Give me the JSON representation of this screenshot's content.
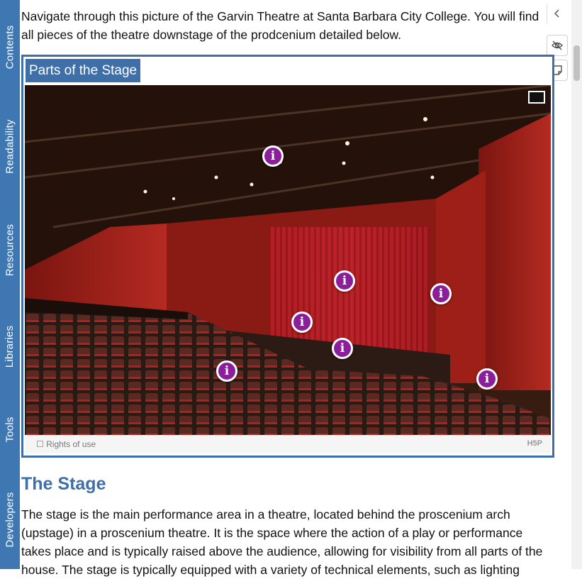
{
  "sidebar": {
    "tabs": [
      {
        "label": "Contents"
      },
      {
        "label": "Readability"
      },
      {
        "label": "Resources"
      },
      {
        "label": "Libraries"
      },
      {
        "label": "Tools"
      },
      {
        "label": "Developers"
      }
    ]
  },
  "toolbar": {
    "collapse_icon": "chevron-left-icon",
    "hide_icon": "eye-off-icon",
    "notes_icon": "sticky-note-icon"
  },
  "intro": "Navigate through this picture of the Garvin Theatre at Santa Barbara City College. You will find all pieces of the theatre downstage of the prodcenium detailed below.",
  "widget": {
    "title": "Parts of the Stage",
    "hotspot_label": "i",
    "rights_label": "Rights of use",
    "brand": "H5P"
  },
  "section": {
    "heading": "The Stage",
    "paragraph": "The stage is the main performance area in a theatre, located behind the proscenium arch (upstage) in a proscenium theatre. It is the space where the action of a play or performance takes place and is typically raised above the audience, allowing for visibility from all parts of the house. The stage is typically equipped with a variety of technical elements, such as lighting"
  },
  "colors": {
    "rail": "#3f77b3",
    "frame": "#3f6fa8",
    "hotspot": "#8a1e9b",
    "heading": "#3f6fa8"
  }
}
